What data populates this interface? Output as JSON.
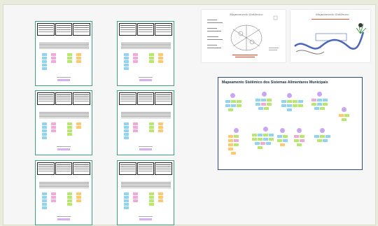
{
  "board": {
    "title": "Mapeamento Sistêmico dos Sistemas Alimentares Municipais"
  },
  "image_cards": {
    "left_title": "Mapeamento Sistêmico",
    "right_title": "Mapeamento Sistêmico"
  },
  "colors": {
    "background": "#e9ebdc",
    "frame_border": "#3aa37b",
    "board_border": "#2d4a7a",
    "sticky_blue": "#8fd4f2",
    "sticky_pink": "#f3a9d8",
    "sticky_green": "#b6e86a",
    "sticky_orange": "#ffc86a",
    "sticky_purple": "#d8b0f2"
  }
}
